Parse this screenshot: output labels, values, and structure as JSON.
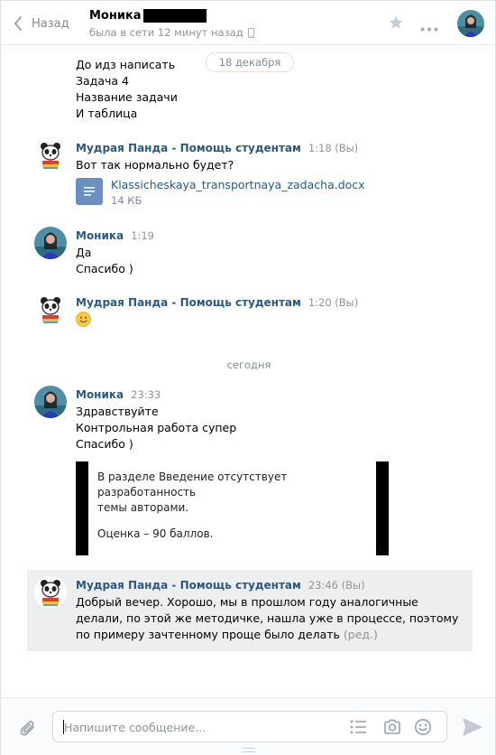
{
  "header": {
    "back_label": "Назад",
    "peer_name": "Моника",
    "peer_status": "была в сети 12 минут назад"
  },
  "dates": {
    "first": "18 декабря",
    "today": "сегодня"
  },
  "messages": {
    "m0": {
      "lines": [
        "До идз написать",
        "Задача 4",
        "Название задачи",
        "И таблица"
      ]
    },
    "m1": {
      "author": "Мудрая Панда - Помощь студентам",
      "time": "1:18 (Вы)",
      "lines": [
        "Вот так нормально будет?"
      ],
      "doc_name": "Klassicheskaya_transportnaya_zadacha.docx",
      "doc_size": "14 КБ"
    },
    "m2": {
      "author": "Моника",
      "time": "1:19",
      "lines": [
        "Да",
        "Спасибо )"
      ]
    },
    "m3": {
      "author": "Мудрая Панда - Помощь студентам",
      "time": "1:20 (Вы)",
      "emoji": "smile"
    },
    "m4": {
      "author": "Моника",
      "time": "23:33",
      "lines": [
        "Здравствуйте",
        "Контрольная работа супер",
        "Спасибо )"
      ],
      "quote_lines": [
        "В разделе Введение отсутствует разработанность",
        "темы авторами.",
        "Оценка – 90 баллов."
      ]
    },
    "m5": {
      "author": "Мудрая Панда - Помощь студентам",
      "time": "23:46 (Вы)",
      "lines": [
        "Добрый вечер. Хорошо, мы в прошлом году аналогичные",
        "делали, по этой же методичке, нашла уже в процессе, поэтому",
        "по примеру зачтенному проще было делать"
      ],
      "edited": "(ред.)"
    }
  },
  "composer": {
    "placeholder": "Напишите сообщение..."
  },
  "colors": {
    "link": "#2a5885",
    "muted": "#939393",
    "highlight_bg": "#edeef0"
  }
}
